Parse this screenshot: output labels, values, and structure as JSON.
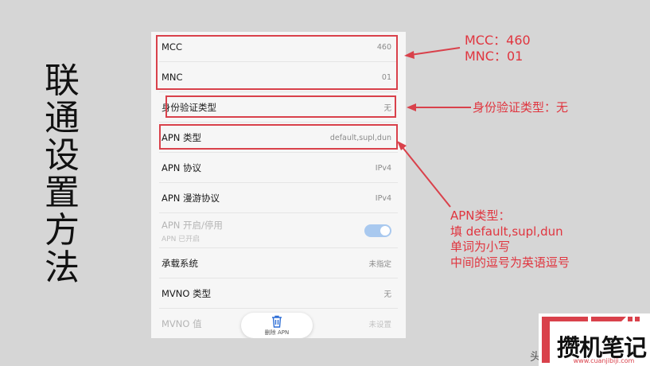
{
  "slide_title": [
    "联",
    "通",
    "设",
    "置",
    "方",
    "法"
  ],
  "settings": {
    "rows": [
      {
        "label": "MCC",
        "value": "460"
      },
      {
        "label": "MNC",
        "value": "01"
      },
      {
        "label": "身份验证类型",
        "value": "无"
      },
      {
        "label": "APN 类型",
        "value": "default,supl,dun"
      },
      {
        "label": "APN 协议",
        "value": "IPv4"
      },
      {
        "label": "APN 漫游协议",
        "value": "IPv4"
      },
      {
        "label": "APN 开启/停用",
        "sub": "APN 已开启",
        "toggle_on": true
      },
      {
        "label": "承载系统",
        "value": "未指定"
      },
      {
        "label": "MVNO 类型",
        "value": "无"
      },
      {
        "label": "MVNO 值",
        "value": "未设置"
      }
    ],
    "delete_button": {
      "label": "删除 APN",
      "icon": "trash-icon"
    }
  },
  "annotations": {
    "mcc_mnc": [
      "MCC：460",
      "MNC：01"
    ],
    "auth": "身份验证类型：无",
    "apn_type": [
      "APN类型：",
      "填 default,supl,dun",
      "单词为小写",
      "中间的逗号为英语逗号"
    ]
  },
  "colors": {
    "highlight": "#d9414b",
    "toggle": "#a9c9ef"
  },
  "watermark": {
    "text": "攒机笔记",
    "url": "www.cuanjibiji.com"
  },
  "corner_text": "头"
}
